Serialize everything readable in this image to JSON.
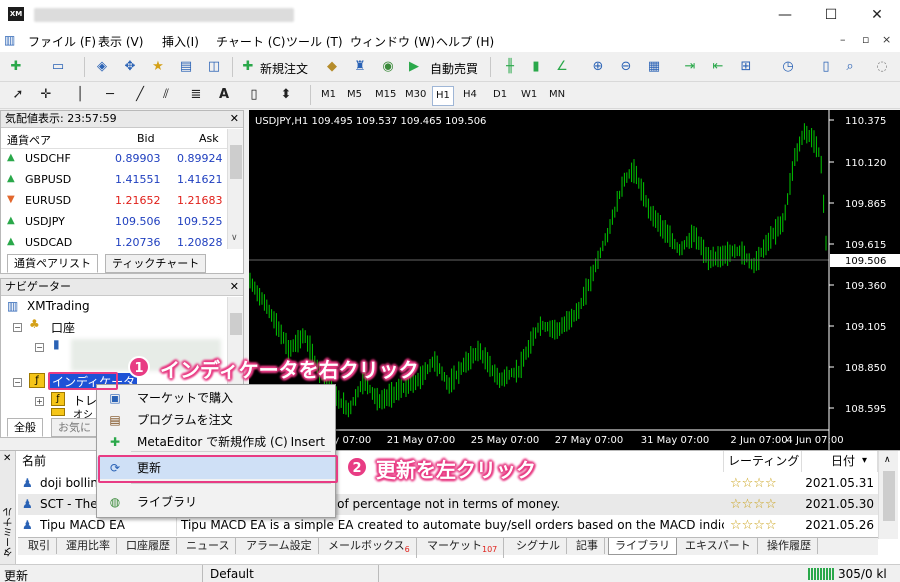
{
  "window": {
    "app_icon": "XM",
    "minimize": "—",
    "maximize": "☐",
    "close": "✕"
  },
  "menu": {
    "items": [
      "ファイル (F)",
      "表示 (V)",
      "挿入(I)",
      "チャート (C)",
      "ツール (T)",
      "ウィンドウ (W)",
      "ヘルプ (H)"
    ],
    "mdi_minimize": "–",
    "mdi_restore": "▫",
    "mdi_close": "×"
  },
  "toolbar1": {
    "new_order": "新規注文",
    "auto_trading": "自動売買"
  },
  "toolbar2": {
    "timeframes": [
      "M1",
      "M5",
      "M15",
      "M30",
      "H1",
      "H4",
      "D1",
      "W1",
      "MN"
    ],
    "active_tf": "H1",
    "text_tool": "A"
  },
  "market_watch": {
    "title": "気配値表示: 23:57:59",
    "headers": [
      "通貨ペア",
      "Bid",
      "Ask"
    ],
    "rows": [
      {
        "symbol": "USDCHF",
        "bid": "0.89903",
        "ask": "0.89924",
        "dir": "up"
      },
      {
        "symbol": "GBPUSD",
        "bid": "1.41551",
        "ask": "1.41621",
        "dir": "up"
      },
      {
        "symbol": "EURUSD",
        "bid": "1.21652",
        "ask": "1.21683",
        "dir": "down"
      },
      {
        "symbol": "USDJPY",
        "bid": "109.506",
        "ask": "109.525",
        "dir": "up"
      },
      {
        "symbol": "USDCAD",
        "bid": "1.20736",
        "ask": "1.20828",
        "dir": "up"
      }
    ],
    "tabs": [
      "通貨ペアリスト",
      "ティックチャート"
    ]
  },
  "navigator": {
    "title": "ナビゲーター",
    "root": "XMTrading",
    "accounts": "口座",
    "indicators": "インディケータ",
    "trend": "トレン",
    "other": "オシ",
    "tabs": [
      "全般",
      "お気に"
    ]
  },
  "chart": {
    "header": "USDJPY,H1  109.495 109.537 109.465 109.506",
    "price_labels": [
      "110.375",
      "110.120",
      "109.865",
      "109.615",
      "109.360",
      "109.105",
      "108.850",
      "108.595"
    ],
    "current_price": "109.506",
    "time_labels": [
      "19 May 07:00",
      "21 May 07:00",
      "25 May 07:00",
      "27 May 07:00",
      "31 May 07:00",
      "2 Jun 07:00",
      "4 Jun 07:00"
    ],
    "candle_color": "#00c800",
    "background": "#000000"
  },
  "context_menu": {
    "items": [
      {
        "icon": "market-icon",
        "glyph": "▣",
        "label": "マーケットで購入",
        "shortcut": ""
      },
      {
        "icon": "order-icon",
        "glyph": "▤",
        "label": "プログラムを注文",
        "shortcut": ""
      },
      {
        "icon": "plus-icon",
        "glyph": "✚",
        "label": "MetaEditor で新規作成 (C)",
        "shortcut": "Insert"
      },
      {
        "icon": "refresh-icon",
        "glyph": "⟳",
        "label": "更新",
        "shortcut": ""
      },
      {
        "icon": "globe-icon",
        "glyph": "◍",
        "label": "ライブラリ",
        "shortcut": ""
      }
    ]
  },
  "annotations": {
    "step1_num": "1",
    "step1_text": "インディケータを右クリック",
    "step2_num": "2",
    "step2_text": "更新を左クリック",
    "accent": "#e83c84"
  },
  "terminal": {
    "side_label": "ターミナル",
    "headers": {
      "name": "名前",
      "rating": "レーティング",
      "date": "日付"
    },
    "rows": [
      {
        "name": "doji bolling",
        "desc": "",
        "date": "2021.05.31"
      },
      {
        "name": "SCT - The C",
        "desc": "by seeing things in terms of percentage not in terms of money.",
        "date": "2021.05.30"
      },
      {
        "name": "Tipu MACD EA",
        "desc": "Tipu MACD EA is a simple EA created to automate buy/sell orders based on the MACD indicator...",
        "date": "2021.05.26"
      }
    ],
    "stars": "☆☆☆☆",
    "tabs": [
      {
        "label": "取引",
        "count": ""
      },
      {
        "label": "運用比率",
        "count": ""
      },
      {
        "label": "口座履歴",
        "count": ""
      },
      {
        "label": "ニュース",
        "count": ""
      },
      {
        "label": "アラーム設定",
        "count": ""
      },
      {
        "label": "メールボックス",
        "count": "6"
      },
      {
        "label": "マーケット",
        "count": "107"
      },
      {
        "label": "シグナル",
        "count": ""
      },
      {
        "label": "記事",
        "count": ""
      },
      {
        "label": "ライブラリ",
        "count": ""
      },
      {
        "label": "エキスパート",
        "count": ""
      },
      {
        "label": "操作履歴",
        "count": ""
      }
    ],
    "active_tab": "ライブラリ"
  },
  "status": {
    "left": "更新",
    "profile": "Default",
    "traffic": "305/0 kl"
  }
}
